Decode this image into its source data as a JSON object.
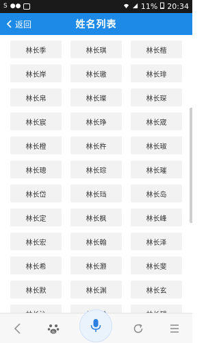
{
  "status_bar": {
    "battery": "11%",
    "time": "20:34"
  },
  "header": {
    "back_label": "返回",
    "title": "姓名列表"
  },
  "names": [
    "林长季",
    "林长琪",
    "林长楷",
    "林长岸",
    "林长璈",
    "林长琲",
    "林长帛",
    "林长璨",
    "林长琛",
    "林长宸",
    "林长琤",
    "林长宬",
    "林长橙",
    "林长杵",
    "林长琡",
    "林长璁",
    "林长琮",
    "林长璀",
    "林长岱",
    "林长珰",
    "林长岛",
    "林长定",
    "林长枫",
    "林长峰",
    "林长宏",
    "林长翰",
    "林长泽",
    "林长希",
    "林长灏",
    "林长斐",
    "林长默",
    "林长渊",
    "林长玄",
    "林长沁",
    "林长瀚",
    "林长望"
  ],
  "bottom_nav": {
    "icons": [
      "back-icon",
      "baidu-paw-icon",
      "microphone-icon",
      "refresh-icon",
      "menu-icon"
    ]
  }
}
